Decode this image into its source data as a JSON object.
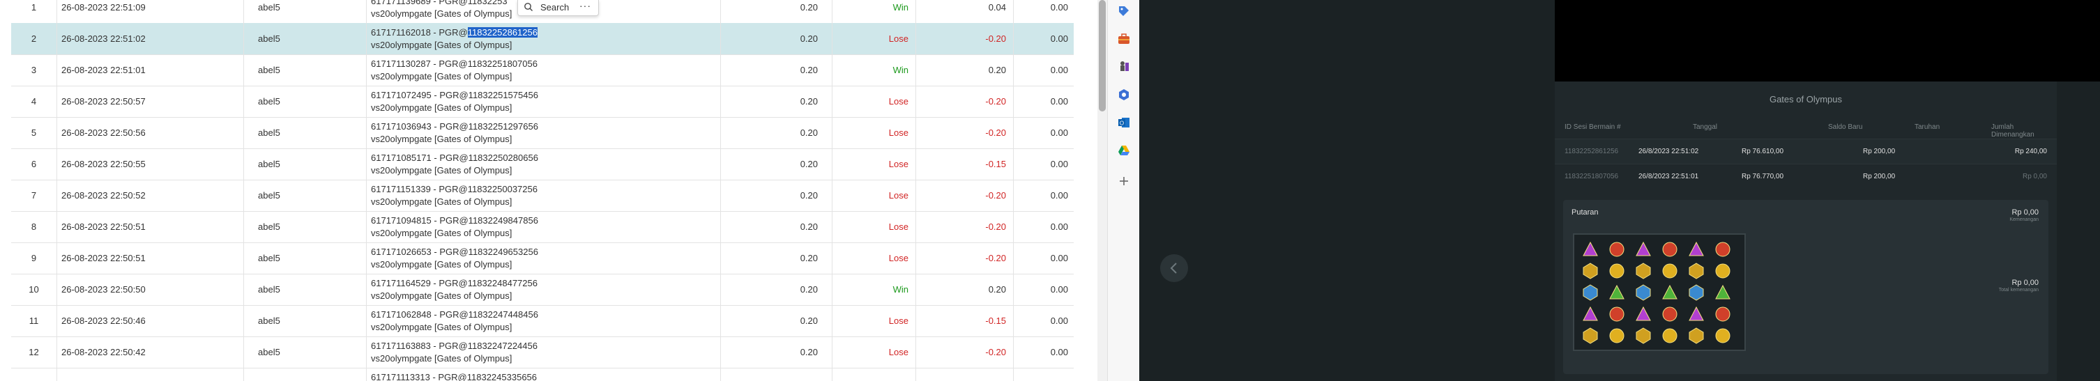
{
  "table": {
    "rows": [
      {
        "no": "1",
        "date": "26-08-2023 22:51:09",
        "user": "abel5",
        "desc_line1": "617171139689 - PGR@11832253",
        "desc_hl": "",
        "desc_line2": "vs20olympgate [Gates of Olympus]",
        "bet": "0.20",
        "result": "Win",
        "win": "0.04",
        "balance": "0.00",
        "selected": false
      },
      {
        "no": "2",
        "date": "26-08-2023 22:51:02",
        "user": "abel5",
        "desc_line1": "617171162018 - PGR@",
        "desc_hl": "11832252861256",
        "desc_line2": "vs20olympgate [Gates of Olympus]",
        "bet": "0.20",
        "result": "Lose",
        "win": "-0.20",
        "balance": "0.00",
        "selected": true
      },
      {
        "no": "3",
        "date": "26-08-2023 22:51:01",
        "user": "abel5",
        "desc_line1": "617171130287 - PGR@11832251807056",
        "desc_hl": "",
        "desc_line2": "vs20olympgate [Gates of Olympus]",
        "bet": "0.20",
        "result": "Win",
        "win": "0.20",
        "balance": "0.00",
        "selected": false
      },
      {
        "no": "4",
        "date": "26-08-2023 22:50:57",
        "user": "abel5",
        "desc_line1": "617171072495 - PGR@11832251575456",
        "desc_hl": "",
        "desc_line2": "vs20olympgate [Gates of Olympus]",
        "bet": "0.20",
        "result": "Lose",
        "win": "-0.20",
        "balance": "0.00",
        "selected": false
      },
      {
        "no": "5",
        "date": "26-08-2023 22:50:56",
        "user": "abel5",
        "desc_line1": "617171036943 - PGR@11832251297656",
        "desc_hl": "",
        "desc_line2": "vs20olympgate [Gates of Olympus]",
        "bet": "0.20",
        "result": "Lose",
        "win": "-0.20",
        "balance": "0.00",
        "selected": false
      },
      {
        "no": "6",
        "date": "26-08-2023 22:50:55",
        "user": "abel5",
        "desc_line1": "617171085171 - PGR@11832250280656",
        "desc_hl": "",
        "desc_line2": "vs20olympgate [Gates of Olympus]",
        "bet": "0.20",
        "result": "Lose",
        "win": "-0.15",
        "balance": "0.00",
        "selected": false
      },
      {
        "no": "7",
        "date": "26-08-2023 22:50:52",
        "user": "abel5",
        "desc_line1": "617171151339 - PGR@11832250037256",
        "desc_hl": "",
        "desc_line2": "vs20olympgate [Gates of Olympus]",
        "bet": "0.20",
        "result": "Lose",
        "win": "-0.20",
        "balance": "0.00",
        "selected": false
      },
      {
        "no": "8",
        "date": "26-08-2023 22:50:51",
        "user": "abel5",
        "desc_line1": "617171094815 - PGR@11832249847856",
        "desc_hl": "",
        "desc_line2": "vs20olympgate [Gates of Olympus]",
        "bet": "0.20",
        "result": "Lose",
        "win": "-0.20",
        "balance": "0.00",
        "selected": false
      },
      {
        "no": "9",
        "date": "26-08-2023 22:50:51",
        "user": "abel5",
        "desc_line1": "617171026653 - PGR@11832249653256",
        "desc_hl": "",
        "desc_line2": "vs20olympgate [Gates of Olympus]",
        "bet": "0.20",
        "result": "Lose",
        "win": "-0.20",
        "balance": "0.00",
        "selected": false
      },
      {
        "no": "10",
        "date": "26-08-2023 22:50:50",
        "user": "abel5",
        "desc_line1": "617171164529 - PGR@11832248477256",
        "desc_hl": "",
        "desc_line2": "vs20olympgate [Gates of Olympus]",
        "bet": "0.20",
        "result": "Win",
        "win": "0.20",
        "balance": "0.00",
        "selected": false
      },
      {
        "no": "11",
        "date": "26-08-2023 22:50:46",
        "user": "abel5",
        "desc_line1": "617171062848 - PGR@11832247448456",
        "desc_hl": "",
        "desc_line2": "vs20olympgate [Gates of Olympus]",
        "bet": "0.20",
        "result": "Lose",
        "win": "-0.15",
        "balance": "0.00",
        "selected": false
      },
      {
        "no": "12",
        "date": "26-08-2023 22:50:42",
        "user": "abel5",
        "desc_line1": "617171163883 - PGR@11832247224456",
        "desc_hl": "",
        "desc_line2": "vs20olympgate [Gates of Olympus]",
        "bet": "0.20",
        "result": "Lose",
        "win": "-0.20",
        "balance": "0.00",
        "selected": false
      },
      {
        "no": "",
        "date": "",
        "user": "",
        "desc_line1": "617171113313 - PGR@11832245335656",
        "desc_hl": "",
        "desc_line2": "",
        "bet": "",
        "result": "",
        "win": "",
        "balance": "",
        "selected": false
      }
    ]
  },
  "search_popup": {
    "label": "Search",
    "more": "···"
  },
  "sidebar_icons": [
    "tag-icon",
    "toolbox-icon",
    "chess-icon",
    "hexagon-icon",
    "outlook-icon",
    "drive-icon",
    "plus-icon"
  ],
  "game": {
    "title": "Gates of Olympus",
    "headers": [
      "ID Sesi Bermain #",
      "Tanggal",
      "Saldo Baru",
      "Taruhan",
      "Jumlah Dimenangkan"
    ],
    "history": [
      {
        "id": "11832252861256",
        "date": "26/8/2023 22:51:02",
        "saldo": "Rp 76.610,00",
        "taruhan": "Rp 200,00",
        "menang": "Rp 240,00"
      },
      {
        "id": "11832251807056",
        "date": "26/8/2023 22:51:01",
        "saldo": "Rp 76.770,00",
        "taruhan": "Rp 200,00",
        "menang": "Rp 0,00"
      }
    ],
    "detail": {
      "label": "Putaran",
      "amount1": "Rp 0,00",
      "sub1": "Kemenangan",
      "amount2": "Rp 0,00",
      "sub2": "Total kemenangan"
    }
  },
  "colors": {
    "win": "#1e9a1e",
    "lose": "#d12424",
    "selected_row": "#cfe7ea",
    "highlight": "#1f63c9",
    "dark_bg": "#1b2224"
  }
}
